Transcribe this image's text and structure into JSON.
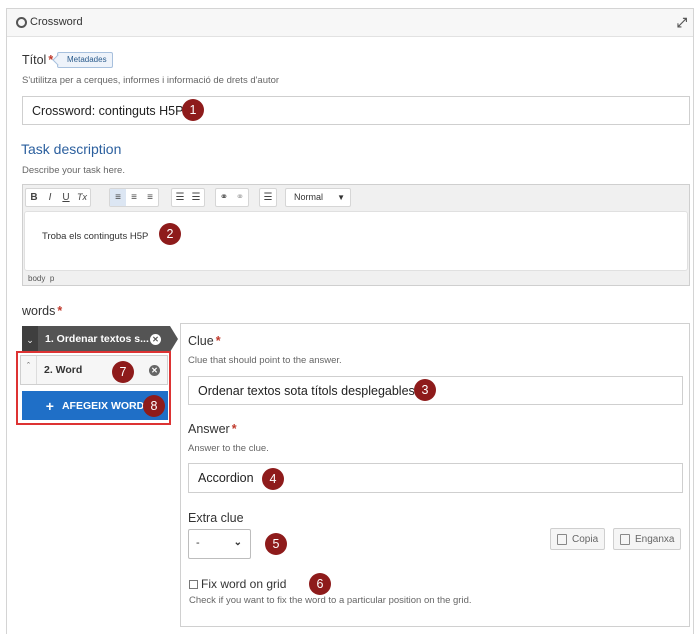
{
  "window": {
    "title": "Crossword",
    "icon": "h5p-icon",
    "expand_icon": "expand-icon"
  },
  "title_field": {
    "label": "Títol",
    "metadata_button": "Metadades",
    "description": "S'utilitza per a cerques, informes i informació de drets d'autor",
    "value": "Crossword: continguts H5P"
  },
  "task_description": {
    "heading": "Task description",
    "description": "Describe your task here.",
    "toolbar": {
      "buttons": [
        "B",
        "I",
        "U",
        "Tx",
        "≡",
        "≡",
        "≡",
        "☰",
        "☰",
        "⚭",
        "⚭",
        "☰"
      ],
      "format_value": "Normal"
    },
    "content": "Troba els continguts H5P",
    "status_path": [
      "body",
      "p"
    ]
  },
  "words": {
    "label": "words",
    "items": [
      {
        "label": "1. Ordenar textos s...",
        "expanded": true
      },
      {
        "label": "2. Word",
        "expanded": false
      }
    ],
    "add_button": "AFEGEIX WORD"
  },
  "word_panel": {
    "clue": {
      "label": "Clue",
      "description": "Clue that should point to the answer.",
      "value": "Ordenar textos sota títols desplegables."
    },
    "answer": {
      "label": "Answer",
      "description": "Answer to the clue.",
      "value": "Accordion"
    },
    "extra_clue": {
      "label": "Extra clue",
      "selected": "-",
      "copy_button": "Copia",
      "paste_button": "Enganxa"
    },
    "fix_word": {
      "label": "Fix word on grid",
      "description": "Check if you want to fix the word to a particular position on the grid.",
      "checked": false
    }
  },
  "callouts": [
    "1",
    "2",
    "3",
    "4",
    "5",
    "6",
    "7",
    "8"
  ],
  "colors": {
    "accent": "#1f6fc7",
    "heading": "#2b5f9e",
    "callout": "#8e1b1b",
    "highlight_border": "#dd3333"
  }
}
